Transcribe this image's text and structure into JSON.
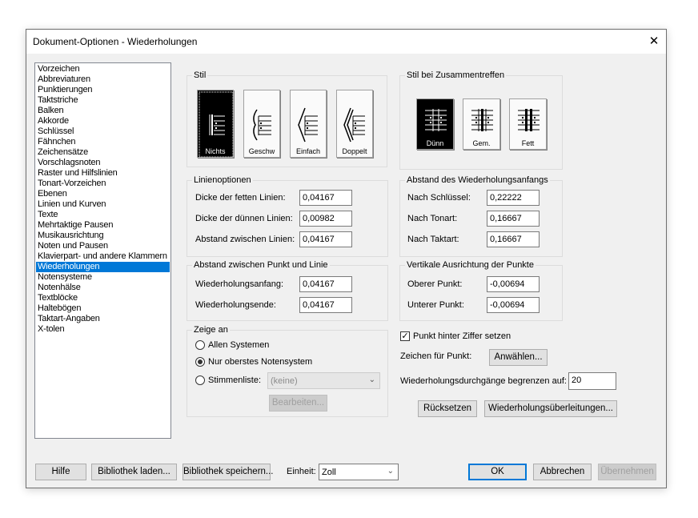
{
  "window": {
    "title": "Dokument-Optionen - Wiederholungen",
    "close_glyph": "✕"
  },
  "sidebar": {
    "items": [
      "Vorzeichen",
      "Abbreviaturen",
      "Punktierungen",
      "Taktstriche",
      "Balken",
      "Akkorde",
      "Schlüssel",
      "Fähnchen",
      "Zeichensätze",
      "Vorschlagsnoten",
      "Raster und Hilfslinien",
      "Tonart-Vorzeichen",
      "Ebenen",
      "Linien und Kurven",
      "Texte",
      "Mehrtaktige Pausen",
      "Musikausrichtung",
      "Noten und Pausen",
      "Klavierpart- und andere Klammern",
      "Wiederholungen",
      "Notensysteme",
      "Notenhälse",
      "Textblöcke",
      "Haltebögen",
      "Taktart-Angaben",
      "X-tolen"
    ],
    "selected": "Wiederholungen"
  },
  "stil": {
    "label": "Stil",
    "buttons": [
      {
        "label": "Nichts",
        "icon": "bracket-none-icon"
      },
      {
        "label": "Geschw",
        "icon": "bracket-curly-icon"
      },
      {
        "label": "Einfach",
        "icon": "bracket-single-icon"
      },
      {
        "label": "Doppelt",
        "icon": "bracket-double-icon"
      }
    ],
    "selected": "Nichts"
  },
  "stil_zusammentreffen": {
    "label": "Stil bei Zusammentreffen",
    "buttons": [
      {
        "label": "Dünn",
        "icon": "barline-thin-icon"
      },
      {
        "label": "Gem.",
        "icon": "barline-mixed-icon"
      },
      {
        "label": "Fett",
        "icon": "barline-thick-icon"
      }
    ],
    "selected": "Dünn"
  },
  "linienoptionen": {
    "label": "Linienoptionen",
    "rows": [
      {
        "label": "Dicke der fetten Linien:",
        "value": "0,04167"
      },
      {
        "label": "Dicke der dünnen Linien:",
        "value": "0,00982"
      },
      {
        "label": "Abstand zwischen Linien:",
        "value": "0,04167"
      }
    ]
  },
  "abstand_anfang": {
    "label": "Abstand des Wiederholungsanfangs",
    "rows": [
      {
        "label": "Nach Schlüssel:",
        "value": "0,22222"
      },
      {
        "label": "Nach Tonart:",
        "value": "0,16667"
      },
      {
        "label": "Nach Taktart:",
        "value": "0,16667"
      }
    ]
  },
  "abstand_punkt": {
    "label": "Abstand zwischen Punkt und Linie",
    "rows": [
      {
        "label": "Wiederholungsanfang:",
        "value": "0,04167"
      },
      {
        "label": "Wiederholungsende:",
        "value": "0,04167"
      }
    ]
  },
  "vertikal": {
    "label": "Vertikale Ausrichtung der Punkte",
    "rows": [
      {
        "label": "Oberer Punkt:",
        "value": "-0,00694"
      },
      {
        "label": "Unterer Punkt:",
        "value": "-0,00694"
      }
    ]
  },
  "zeige_an": {
    "label": "Zeige an",
    "options": [
      "Allen Systemen",
      "Nur oberstes Notensystem",
      "Stimmenliste:"
    ],
    "selected": "Nur oberstes Notensystem",
    "stimmen_value": "(keine)",
    "edit_label": "Bearbeiten..."
  },
  "punkt": {
    "checkbox_label": "Punkt hinter Ziffer setzen",
    "checked": true,
    "check_glyph": "✓",
    "zeichen_label": "Zeichen für Punkt:",
    "anwaehlen_label": "Anwählen...",
    "limit_label": "Wiederholungsdurchgänge begrenzen auf:",
    "limit_value": "20",
    "reset_label": "Rücksetzen",
    "transitions_label": "Wiederholungsüberleitungen..."
  },
  "footer": {
    "help": "Hilfe",
    "load": "Bibliothek laden...",
    "save": "Bibliothek speichern...",
    "unit_label": "Einheit:",
    "unit_value": "Zoll",
    "ok": "OK",
    "cancel": "Abbrechen",
    "apply": "Übernehmen"
  },
  "colors": {
    "accent": "#0078d7",
    "dialog_bg": "#f0f0f0"
  }
}
